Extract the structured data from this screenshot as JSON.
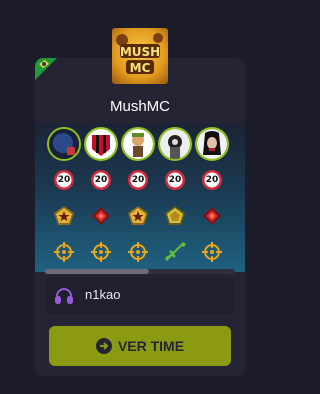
{
  "team": {
    "name": "MushMC",
    "logo_icon": "mushmc-logo-icon",
    "flag_icon": "brazil-flag-icon"
  },
  "players": [
    {
      "avatar": "player-avatar-1",
      "level": "20",
      "rank_icon": "gold-star-rank-icon",
      "role_icon": "crosshair-icon"
    },
    {
      "avatar": "player-avatar-2",
      "level": "20",
      "rank_icon": "red-diamond-rank-icon",
      "role_icon": "crosshair-icon"
    },
    {
      "avatar": "player-avatar-3",
      "level": "20",
      "rank_icon": "gold-star-rank-icon",
      "role_icon": "crosshair-icon"
    },
    {
      "avatar": "player-avatar-4",
      "level": "20",
      "rank_icon": "gold-pentagon-rank-icon",
      "role_icon": "rifle-icon"
    },
    {
      "avatar": "player-avatar-5",
      "level": "20",
      "rank_icon": "red-diamond-rank-icon",
      "role_icon": "crosshair-icon"
    }
  ],
  "coach": {
    "name": "n1kao",
    "icon": "headset-icon"
  },
  "button": {
    "label": "VER TIME",
    "icon": "arrow-circle-right-icon"
  },
  "colors": {
    "background": "#1d1c2b",
    "card": "#252435",
    "accent": "#8b9a10",
    "avatar_border": "#8fc21a",
    "level_red": "#d42a3c",
    "crosshair": "#e7a51a"
  }
}
